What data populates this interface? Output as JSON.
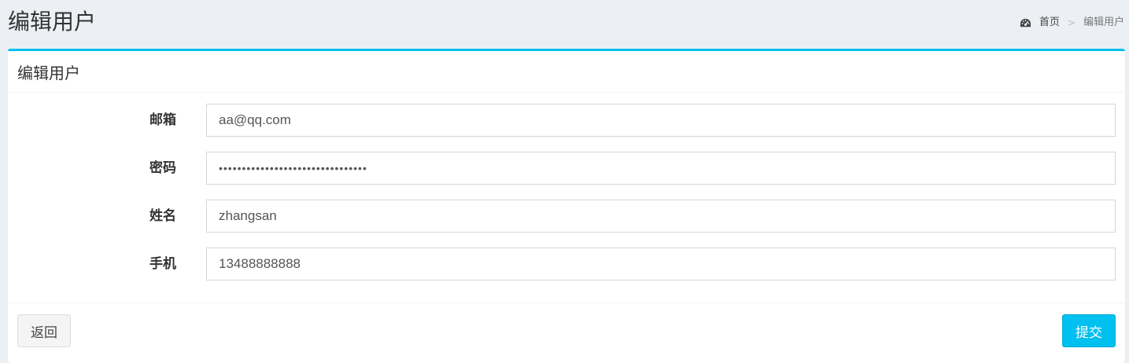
{
  "header": {
    "title": "编辑用户",
    "breadcrumb": {
      "home_icon": "dashboard-icon",
      "home_label": "首页",
      "separator": ">",
      "current": "编辑用户"
    }
  },
  "box": {
    "title": "编辑用户",
    "accent_color": "#00c0ef",
    "fields": [
      {
        "label": "邮箱",
        "value": "aa@qq.com"
      },
      {
        "label": "密码",
        "value": "••••••••••••••••••••••••••••••••"
      },
      {
        "label": "姓名",
        "value": "zhangsan"
      },
      {
        "label": "手机",
        "value": "13488888888"
      }
    ],
    "back_label": "返回",
    "submit_label": "提交"
  }
}
